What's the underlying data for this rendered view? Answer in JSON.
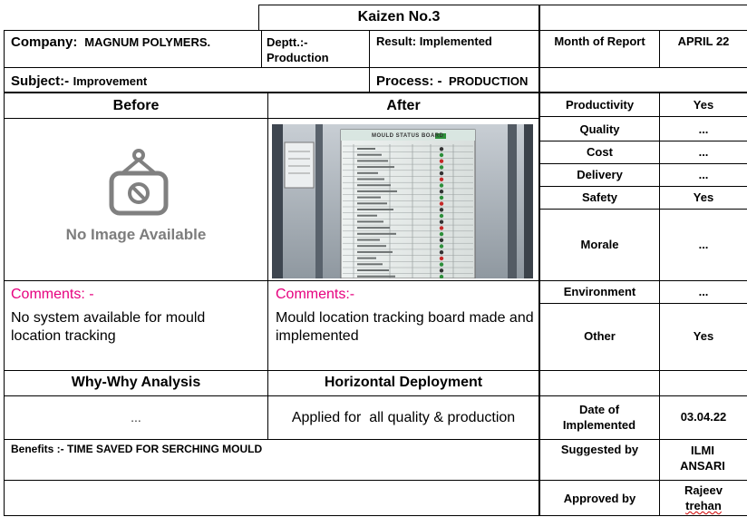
{
  "title": "Kaizen No.3",
  "company": {
    "label": "Company:",
    "value": "MAGNUM POLYMERS."
  },
  "dept": {
    "label": "Deptt.:-",
    "value": "Production"
  },
  "result": {
    "label": "Result:",
    "value": "Implemented"
  },
  "month": {
    "label": "Month of Report",
    "value": "APRIL 22"
  },
  "subject": {
    "label": "Subject:-",
    "value": "Improvement"
  },
  "process": {
    "label": "Process: -",
    "value": "PRODUCTION"
  },
  "before": {
    "heading": "Before",
    "placeholder_text": "No Image Available",
    "comments_label": "Comments: -",
    "comments": "No system available for mould location tracking"
  },
  "after": {
    "heading": "After",
    "photo_board_title": "MOULD STATUS BOARD",
    "comments_label": "Comments:-",
    "comments": "Mould location tracking board made and implemented"
  },
  "benefits_table": [
    {
      "label": "Productivity",
      "value": "Yes"
    },
    {
      "label": "Quality",
      "value": "..."
    },
    {
      "label": "Cost",
      "value": "..."
    },
    {
      "label": "Delivery",
      "value": "..."
    },
    {
      "label": "Safety",
      "value": "Yes"
    },
    {
      "label": "Morale",
      "value": "..."
    },
    {
      "label": "Environment",
      "value": "..."
    },
    {
      "label": "Other",
      "value": "Yes"
    }
  ],
  "why_why": {
    "heading": "Why-Why Analysis",
    "value": "..."
  },
  "horizontal": {
    "heading": "Horizontal Deployment",
    "value": "Applied for  all quality & production"
  },
  "date_implemented": {
    "label": "Date of Implemented",
    "value": "03.04.22"
  },
  "benefits": {
    "label": "Benefits :-",
    "value": "TIME SAVED FOR SERCHING MOULD"
  },
  "suggested_by": {
    "label": "Suggested by",
    "value": "ILMI ANSARI"
  },
  "approved_by": {
    "label": "Approved by",
    "value_first": "Rajeev",
    "value_second": "trehan"
  },
  "colors": {
    "comments_label": "#e6007e",
    "border": "#000000"
  }
}
